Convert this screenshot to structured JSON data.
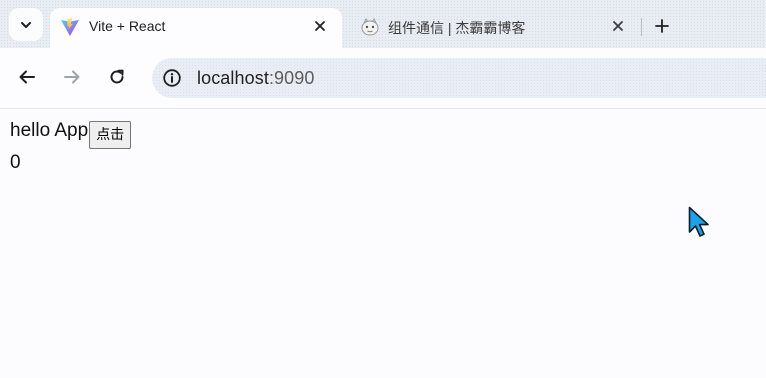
{
  "browser": {
    "tabs": [
      {
        "title": "Vite + React",
        "active": true,
        "favicon": "vite-logo"
      },
      {
        "title": "组件通信 | 杰霸霸博客",
        "active": false,
        "favicon": "blog-logo"
      }
    ],
    "address": {
      "host": "localhost",
      "port": ":9090"
    }
  },
  "page": {
    "greeting": "hello App",
    "button_label": "点击",
    "count": "0"
  }
}
